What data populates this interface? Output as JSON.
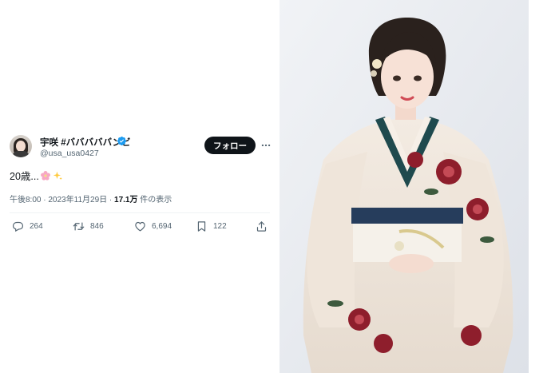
{
  "tweet": {
    "display_name": "宇咲 #バババババンビ",
    "handle": "@usa_usa0427",
    "follow_label": "フォロー",
    "text": "20歳...",
    "time": "午後8:00",
    "separator": "·",
    "date": "2023年11月29日",
    "views_count": "17.1万",
    "views_label": "件の表示",
    "replies": "264",
    "retweets": "846",
    "likes": "6,694",
    "bookmarks": "122"
  },
  "colors": {
    "text": "#0f1419",
    "muted": "#536471",
    "verified": "#1d9bf0",
    "button_bg": "#0f1419"
  },
  "icons": [
    "verified-badge-icon",
    "more-icon",
    "cherry-blossom-icon",
    "sparkles-icon",
    "reply-icon",
    "retweet-icon",
    "like-icon",
    "bookmark-icon",
    "share-icon"
  ]
}
